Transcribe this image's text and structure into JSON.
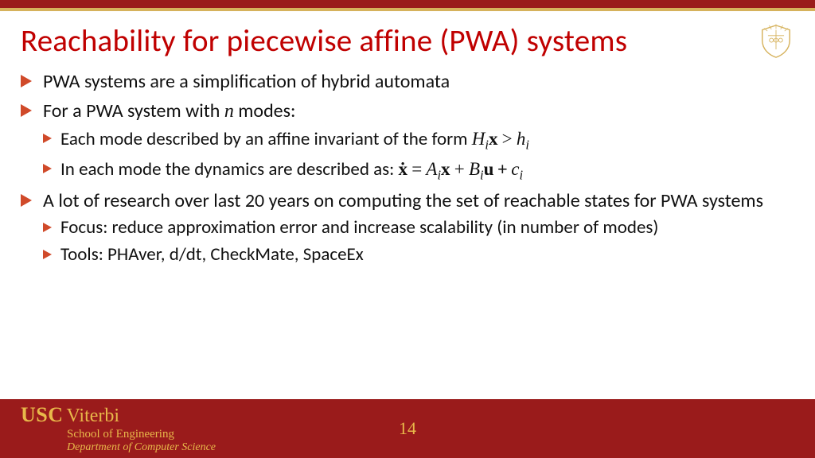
{
  "title": "Reachability for piecewise affine (PWA) systems",
  "bullets": {
    "b1": "PWA systems are a simplification of hybrid automata",
    "b2_pre": "For a PWA system with ",
    "b2_n": "n",
    "b2_post": " modes:",
    "b2a_pre": "Each mode described by an affine invariant of the form ",
    "b2b_pre": "In each mode the dynamics are described as: ",
    "b3": "A lot of research over last 20 years on computing the set of reachable states for PWA systems",
    "b3a": "Focus: reduce approximation error and increase scalability (in number of modes)",
    "b3b": "Tools: PHAver, d/dt, CheckMate, SpaceEx"
  },
  "math": {
    "H": "H",
    "x": "x",
    "gt": ">",
    "h": "h",
    "i": "i",
    "xdot": "ẋ",
    "eq": "=",
    "A": "A",
    "plus": "+",
    "B": "B",
    "u": "u",
    "c": "c"
  },
  "footer": {
    "usc": "USC",
    "viterbi": "Viterbi",
    "school": "School of Engineering",
    "dept": "Department of Computer Science",
    "page": "14"
  }
}
